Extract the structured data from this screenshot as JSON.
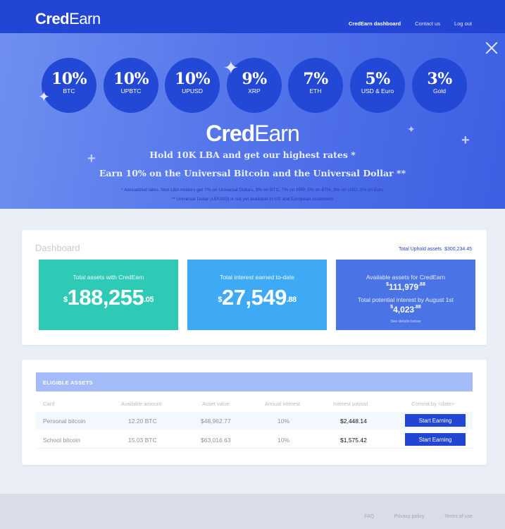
{
  "nav": {
    "brand_cred": "Cred",
    "brand_earn": "Earn",
    "links": [
      "CredEarn dashboard",
      "Contact us",
      "Log out"
    ]
  },
  "hero": {
    "rates": [
      {
        "pct": "10%",
        "asset": "BTC"
      },
      {
        "pct": "10%",
        "asset": "UPBTC"
      },
      {
        "pct": "10%",
        "asset": "UPUSD"
      },
      {
        "pct": "9%",
        "asset": "XRP"
      },
      {
        "pct": "7%",
        "asset": "ETH"
      },
      {
        "pct": "5%",
        "asset": "USD & Euro"
      },
      {
        "pct": "3%",
        "asset": "Gold"
      }
    ],
    "logo_cred": "Cred",
    "logo_earn": "Earn",
    "line1": "Hold 10K LBA and get our highest rates *",
    "line2": "Earn 10% on the Universal Bitcoin and the Universal Dollar **",
    "note1": "* Annualized rates. Non-LBA holders get 7% on Universal Dollars, 8% on BTC, 7% on XRP, 5% on ETH, 3% on USD, 3% on Euro",
    "note2": "** Universal Dollar (UPUSD) is not yet available to US and European customers"
  },
  "dashboard": {
    "title": "Dashboard",
    "total_uphold_label": "Total Uphold assets",
    "total_uphold_value": "$300,234.45",
    "total_assets": {
      "label": "Total assets with CredEarn",
      "currency": "$",
      "whole": "188,255",
      "cents": ".05"
    },
    "total_interest": {
      "label": "Total interest earned to-date",
      "currency": "$",
      "whole": "27,549",
      "cents": ".88"
    },
    "available": {
      "label": "Available assets for CredEarn",
      "currency": "$",
      "whole": "111,979",
      "cents": ".88",
      "potential_label": "Total potential interest by August 1st",
      "potential_currency": "$",
      "potential_whole": "4,023",
      "potential_cents": ".88",
      "details_link": "See details below"
    }
  },
  "assets": {
    "header": "ELIGIBLE ASSETS",
    "columns": [
      "Card",
      "Available amount",
      "Asset value",
      "Annual interest",
      "Interest payout",
      "Commit by <date>"
    ],
    "rows": [
      {
        "card": "Personal bitcoin",
        "amount": "12.20 BTC",
        "value": "$48,962.77",
        "interest": "10%",
        "payout": "$2,448.14",
        "button": "Start Earning"
      },
      {
        "card": "School bitcoin",
        "amount": "15.03 BTC",
        "value": "$63,016.63",
        "interest": "10%",
        "payout": "$1,575.42",
        "button": "Start Earning"
      }
    ]
  },
  "footer": {
    "links": [
      "FAQ",
      "Privacy policy",
      "Terms of use"
    ]
  },
  "colors": {
    "nav_bg": "#2345d3",
    "teal_box": "#2fcab6",
    "sky_box": "#3eaaf5",
    "blue_box": "#4a73e6",
    "button": "#2345d3"
  },
  "icons": [
    "close-icon",
    "sparkle-icon",
    "plus-icon"
  ]
}
